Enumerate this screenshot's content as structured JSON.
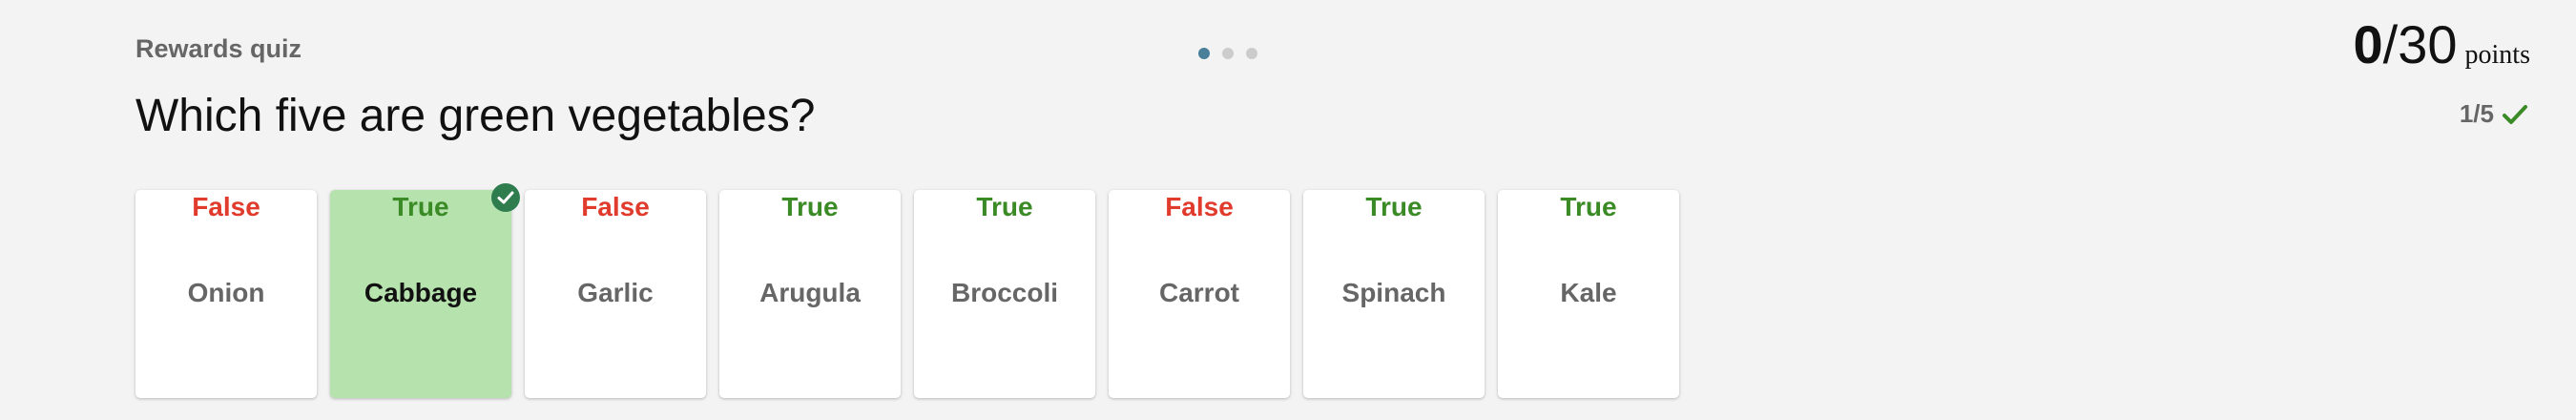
{
  "quiz": {
    "title": "Rewards quiz",
    "question": "Which five are green vegetables?",
    "page_dots": {
      "count": 3,
      "active_index": 0
    },
    "score": {
      "current": "0",
      "separator": "/",
      "total": "30",
      "unit": "points"
    },
    "progress": {
      "text": "1/5",
      "icon": "checkmark-icon"
    }
  },
  "options": [
    {
      "name": "Onion",
      "verdict": "False",
      "correct": false,
      "selected": false
    },
    {
      "name": "Cabbage",
      "verdict": "True",
      "correct": true,
      "selected": true
    },
    {
      "name": "Garlic",
      "verdict": "False",
      "correct": false,
      "selected": false
    },
    {
      "name": "Arugula",
      "verdict": "True",
      "correct": true,
      "selected": false
    },
    {
      "name": "Broccoli",
      "verdict": "True",
      "correct": true,
      "selected": false
    },
    {
      "name": "Carrot",
      "verdict": "False",
      "correct": false,
      "selected": false
    },
    {
      "name": "Spinach",
      "verdict": "True",
      "correct": true,
      "selected": false
    },
    {
      "name": "Kale",
      "verdict": "True",
      "correct": true,
      "selected": false
    }
  ],
  "colors": {
    "true": "#3a8a25",
    "false": "#e03b2c",
    "selected_bg": "#b6e2ae",
    "check_badge": "#2f7d4f",
    "active_dot": "#4a7f9a"
  }
}
